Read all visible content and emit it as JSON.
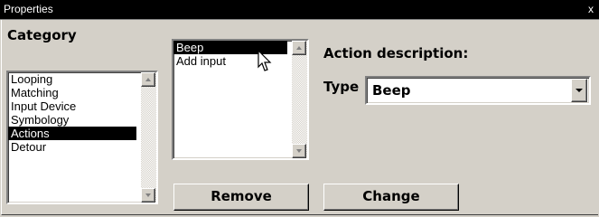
{
  "window": {
    "title": "Properties",
    "close_glyph": "x"
  },
  "category": {
    "heading": "Category",
    "items": [
      "Looping",
      "Matching",
      "Input Device",
      "Symbology",
      "Actions",
      "Detour"
    ],
    "selected": "Actions"
  },
  "actions_list": {
    "items": [
      "Beep",
      "Add input"
    ],
    "selected": "Beep"
  },
  "action_description": {
    "heading": "Action description:",
    "type_label": "Type",
    "type_value": "Beep"
  },
  "buttons": {
    "remove_label": "Remove",
    "change_label": "Change"
  },
  "icons": {
    "cursor": "arrow-cursor-icon",
    "scroll_up": "scroll-up-arrow-icon",
    "scroll_down": "scroll-down-arrow-icon",
    "dropdown": "dropdown-arrow-icon"
  },
  "colors": {
    "titlebar_bg": "#000000",
    "selection_bg": "#000000",
    "dialog_bg": "#d4d0c8"
  }
}
